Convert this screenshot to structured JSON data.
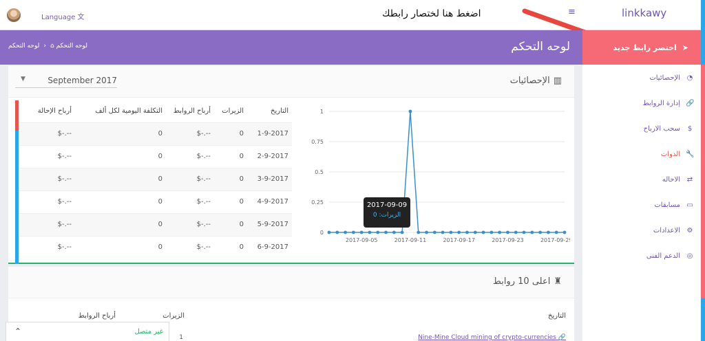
{
  "topbar": {
    "language_label": "Language",
    "language_icon": "translate-icon",
    "brand": "linkkawy",
    "callout": "اضغط هنا لختصار رابطك"
  },
  "header": {
    "page_title": "لوحه التحكم",
    "breadcrumb": [
      "لوحه التحكم",
      "لوحه التحكم"
    ]
  },
  "sidebar": {
    "new_link": "اختصر رابط جديد",
    "items": [
      {
        "label": "الإحصائيات",
        "icon": "dashboard-icon"
      },
      {
        "label": "إدارة الروابط",
        "icon": "link-icon"
      },
      {
        "label": "سحب الارباح",
        "icon": "dollar-icon"
      },
      {
        "label": "الدوات",
        "icon": "wrench-icon",
        "active": true
      },
      {
        "label": "الاحاله",
        "icon": "exchange-icon"
      },
      {
        "label": "مسابقات",
        "icon": "card-icon"
      },
      {
        "label": "الاعدادات",
        "icon": "cogs-icon"
      },
      {
        "label": "الدعم الفنى",
        "icon": "support-icon"
      }
    ]
  },
  "stats": {
    "title": "الإحصائيات",
    "month_select": "September 2017",
    "table_headers": {
      "date": "التاريخ",
      "visits": "الزيرات",
      "link_earnings": "أرباح الروابط",
      "daily_cpm": "التكلفة اليومية لكل ألف",
      "referral": "أرباح الإحالة"
    },
    "rows": [
      {
        "date": "1-9-2017",
        "visits": "0",
        "link_earnings": "$-.--",
        "daily_cpm": "0",
        "referral": "$-.--"
      },
      {
        "date": "2-9-2017",
        "visits": "0",
        "link_earnings": "$-.--",
        "daily_cpm": "0",
        "referral": "$-.--"
      },
      {
        "date": "3-9-2017",
        "visits": "0",
        "link_earnings": "$-.--",
        "daily_cpm": "0",
        "referral": "$-.--"
      },
      {
        "date": "4-9-2017",
        "visits": "0",
        "link_earnings": "$-.--",
        "daily_cpm": "0",
        "referral": "$-.--"
      },
      {
        "date": "5-9-2017",
        "visits": "0",
        "link_earnings": "$-.--",
        "daily_cpm": "0",
        "referral": "$-.--"
      },
      {
        "date": "6-9-2017",
        "visits": "0",
        "link_earnings": "$-.--",
        "daily_cpm": "0",
        "referral": "$-.--"
      }
    ],
    "tooltip": {
      "date": "2017-09-09",
      "value": "الزيرات: 0"
    }
  },
  "chart_data": {
    "type": "line",
    "x": [
      "2017-09-01",
      "2017-09-02",
      "2017-09-03",
      "2017-09-04",
      "2017-09-05",
      "2017-09-06",
      "2017-09-07",
      "2017-09-08",
      "2017-09-09",
      "2017-09-10",
      "2017-09-11",
      "2017-09-12",
      "2017-09-13",
      "2017-09-14",
      "2017-09-15",
      "2017-09-16",
      "2017-09-17",
      "2017-09-18",
      "2017-09-19",
      "2017-09-20",
      "2017-09-21",
      "2017-09-22",
      "2017-09-23",
      "2017-09-24",
      "2017-09-25",
      "2017-09-26",
      "2017-09-27",
      "2017-09-28",
      "2017-09-29",
      "2017-09-30"
    ],
    "series": [
      {
        "values": [
          0,
          0,
          0,
          0,
          0,
          0,
          0,
          0,
          0,
          0,
          1,
          0,
          0,
          0,
          0,
          0,
          0,
          0,
          0,
          0,
          0,
          0,
          0,
          0,
          0,
          0,
          0,
          0,
          0,
          0
        ]
      }
    ],
    "x_ticks": [
      "2017-09-05",
      "2017-09-11",
      "2017-09-17",
      "2017-09-23",
      "2017-09-29"
    ],
    "y_ticks": [
      "0",
      "0.25",
      "0.5",
      "0.75",
      "1"
    ],
    "ylim": [
      0,
      1
    ],
    "grid": true,
    "color": "#3a8fc7"
  },
  "top_links": {
    "title": "اعلى 10 روابط",
    "headers": {
      "date": "التاريخ",
      "visits": "الزيرات",
      "link_earnings": "أرباح الروابط"
    },
    "first_row": {
      "title": "Nine-Mine Cloud mining of crypto-currencies",
      "visits": "1"
    }
  },
  "chat": {
    "status": "غير متصل"
  }
}
